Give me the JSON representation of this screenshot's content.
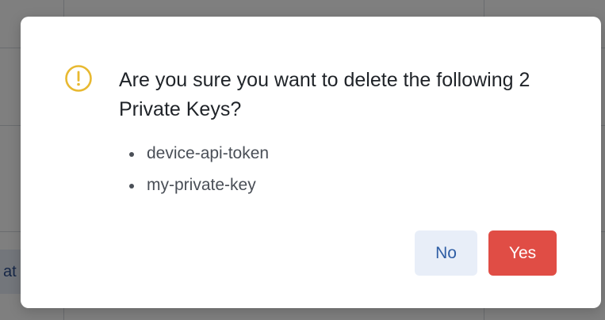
{
  "background": {
    "partial_text": "at"
  },
  "dialog": {
    "icon": "exclamation-circle-icon",
    "title": "Are you sure you want to delete the following 2 Private Keys?",
    "items": [
      "device-api-token",
      "my-private-key"
    ],
    "buttons": {
      "no_label": "No",
      "yes_label": "Yes"
    }
  },
  "colors": {
    "warning": "#E8B931",
    "danger": "#E04D45",
    "secondary_bg": "#E8EEF8",
    "secondary_text": "#2F5EA5"
  }
}
